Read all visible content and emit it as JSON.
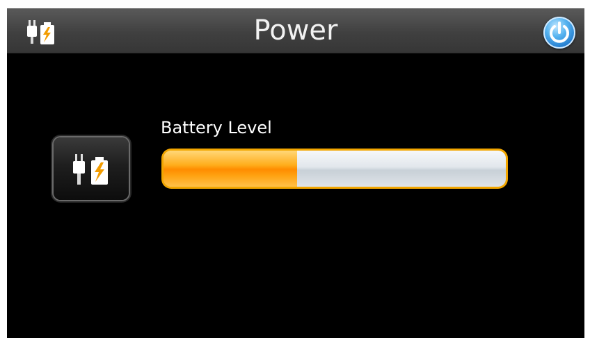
{
  "header": {
    "title": "Power",
    "left_icon": "battery-charging-icon",
    "right_icon": "power-icon"
  },
  "battery": {
    "label": "Battery Level",
    "level_fraction": 0.39,
    "tile_icon": "battery-charging-icon"
  },
  "colors": {
    "accent_orange": "#ff9a00",
    "power_blue": "#2f8fe0",
    "background": "#000000"
  }
}
